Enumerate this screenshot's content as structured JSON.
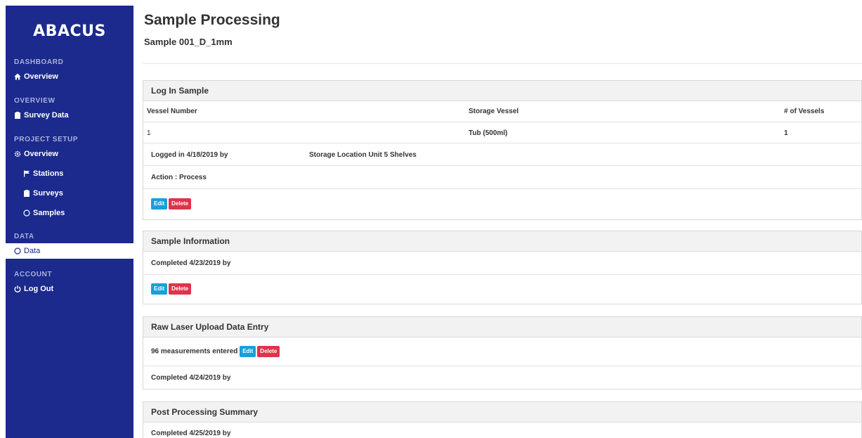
{
  "brand": {
    "logo": "ABACUS"
  },
  "sidebar": {
    "sections": [
      {
        "heading": "DASHBOARD",
        "items": [
          {
            "label": "Overview",
            "icon": "home-icon"
          }
        ]
      },
      {
        "heading": "OVERVIEW",
        "items": [
          {
            "label": "Survey Data",
            "icon": "clipboard-icon"
          }
        ]
      },
      {
        "heading": "PROJECT SETUP",
        "items": [
          {
            "label": "Overview",
            "icon": "gear-icon"
          },
          {
            "label": "Stations",
            "icon": "flag-icon"
          },
          {
            "label": "Surveys",
            "icon": "clipboard-icon"
          },
          {
            "label": "Samples",
            "icon": "circle-icon"
          }
        ]
      },
      {
        "heading": "DATA",
        "items": [
          {
            "label": "Data",
            "icon": "circle-icon",
            "active": true
          }
        ]
      },
      {
        "heading": "ACCOUNT",
        "items": [
          {
            "label": "Log Out",
            "icon": "power-icon"
          }
        ]
      }
    ]
  },
  "page": {
    "title": "Sample Processing",
    "subtitle": "Sample 001_D_1mm"
  },
  "log_in_sample": {
    "header": "Log In Sample",
    "columns": [
      "Vessel Number",
      "Storage Vessel",
      "# of Vessels"
    ],
    "row": [
      "1",
      "Tub (500ml)",
      "1"
    ],
    "logged_in": "Logged in 4/18/2019 by",
    "storage_location": "Storage Location Unit 5 Shelves",
    "action": "Action : Process",
    "edit": "Edit",
    "delete": "Delete"
  },
  "sample_information": {
    "header": "Sample Information",
    "completed": "Completed 4/23/2019 by",
    "edit": "Edit",
    "delete": "Delete"
  },
  "raw_laser": {
    "header": "Raw Laser Upload Data Entry",
    "measurements": "96 measurements entered",
    "edit": "Edit",
    "delete": "Delete",
    "completed": "Completed 4/24/2019 by"
  },
  "post_processing": {
    "header": "Post Processing Summary",
    "completed": "Completed 4/25/2019 by"
  },
  "colors": {
    "sidebar_bg": "#1b2a8c",
    "edit_button": "#1a9fd8",
    "delete_button": "#e0334a",
    "card_header_bg": "#f2f2f2"
  }
}
